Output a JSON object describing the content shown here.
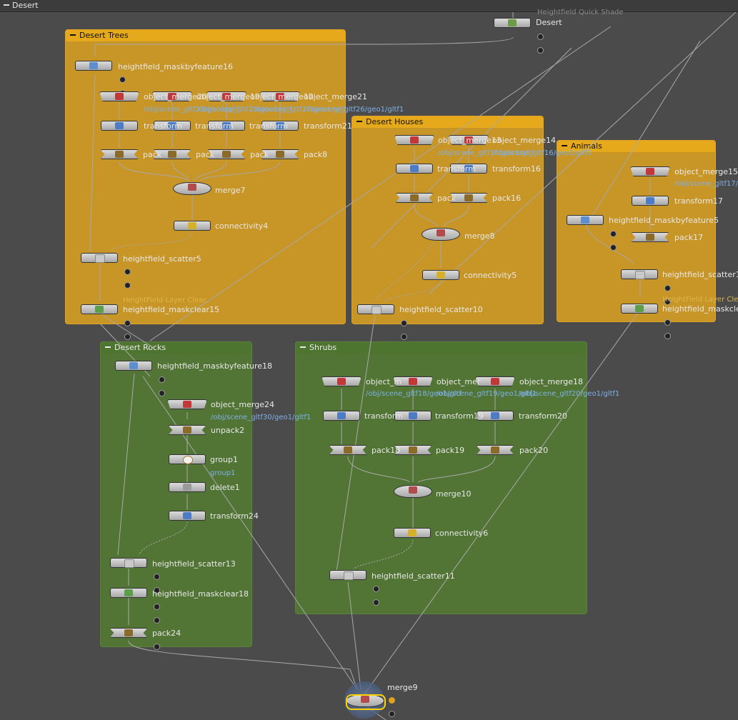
{
  "window": {
    "title": "Desert"
  },
  "network_boxes": {
    "desert_trees": "Desert Trees",
    "desert_houses": "Desert Houses",
    "animals": "Animals",
    "desert_rocks": "Desert Rocks",
    "shrubs": "Shrubs"
  },
  "nodes": {
    "desert": "Desert",
    "desert_faint": "Heightfield Quick Shade",
    "hf_maskbyfeature16": "heightfield_maskbyfeature16",
    "om_a": "object_merge20",
    "om_b": "object_merge19",
    "om_c": "object_merge12",
    "om_21": "object_merge21",
    "om_path_a": "/obj/scene_gltf25/geo1/gltf",
    "om_path_b": "/obj/scene_gltf23/geo1/gltf",
    "om_path_c": "/obj/scene_gltf27/geo1/gltf",
    "om_path_d": "/obj/scene_gltf26/geo1/gltf1",
    "tr_a": "transform",
    "tr_b": "transform",
    "tr_c": "transform",
    "tr_21": "transform21",
    "pk_a": "pack",
    "pk_b": "pack",
    "pk_c": "pack",
    "pk_8": "pack8",
    "merge7": "merge7",
    "connectivity4": "connectivity4",
    "hf_scatter5": "heightfield_scatter5",
    "hf_layerclear_faint": "HeightField Layer Clear",
    "hf_maskclear15": "heightfield_maskclear15",
    "h_om13": "object_merge13",
    "h_om14": "object_merge14",
    "h_path_a": "/obj/scene_gltf15/geo1/gltf",
    "h_path_b": "/obj/scene_gltf16/geo1/gltf1",
    "h_tr_a": "transform",
    "h_tr16": "transform16",
    "h_pk_a": "pack",
    "h_pk16": "pack16",
    "merge8": "merge8",
    "connectivity5": "connectivity5",
    "hf_scatter10": "heightfield_scatter10",
    "a_om15": "object_merge15",
    "a_path": "/obj/scene_gltf17/g",
    "a_tr17": "transform17",
    "a_maskbyfeature5": "heightfield_maskbyfeature5",
    "a_pk17": "pack17",
    "a_scatter1": "heightfield_scatter1",
    "a_layerclear_faint": "HeightField Layer Clear",
    "a_maskclear": "heightfield_maskclea",
    "r_maskbyfeature18": "heightfield_maskbyfeature18",
    "r_om24": "object_merge24",
    "r_om24_path": "/obj/scene_gltf30/geo1/gltf1",
    "r_unpack2": "unpack2",
    "r_group1": "group1",
    "r_group1_sub": "group1",
    "r_delete1": "delete1",
    "r_transform24": "transform24",
    "r_scatter13": "heightfield_scatter13",
    "r_maskclear18": "heightfield_maskclear18",
    "r_pack24": "pack24",
    "s_om_a": "object_m",
    "s_om_b": "object_mer",
    "s_om18": "object_merge18",
    "s_path_a": "/obj/scene_gltf18/geo1/gltf",
    "s_path_b": "/obj/scene_gltf19/geo1/gltf1",
    "s_path_c": "/obj/scene_gltf20/geo1/gltf1",
    "s_tr_a": "transform",
    "s_tr19": "transform19",
    "s_tr20": "transform20",
    "s_pk18": "pack18",
    "s_pk19": "pack19",
    "s_pk20": "pack20",
    "merge10": "merge10",
    "connectivity6": "connectivity6",
    "s_scatter11": "heightfield_scatter11",
    "merge9": "merge9"
  },
  "colors": {
    "yellow_box": "#c89527",
    "green_box": "#527535",
    "wire": "#9a9a9a",
    "selection": "#ffd400"
  }
}
